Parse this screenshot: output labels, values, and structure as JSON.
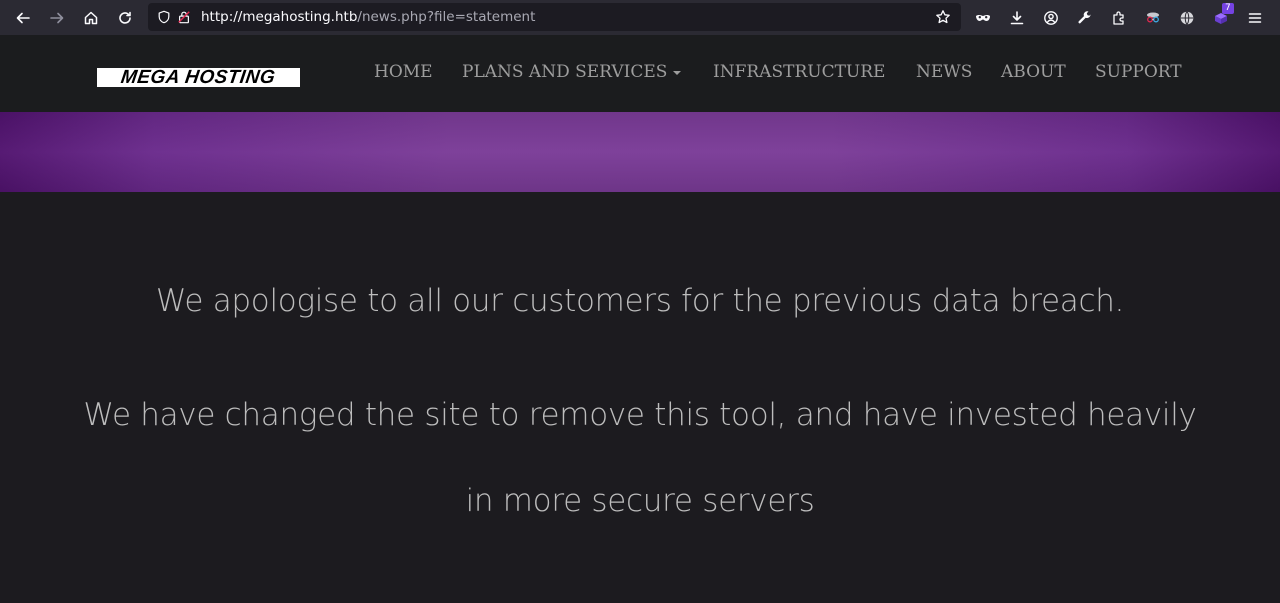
{
  "browser": {
    "url_host": "http://megahosting.htb",
    "url_path": "/news.php?file=statement",
    "extensions_badge": "7",
    "icons": [
      "back-arrow-icon",
      "forward-arrow-icon",
      "home-icon",
      "reload-icon",
      "shield-icon",
      "lock-insecure-icon",
      "star-icon",
      "mask-icon",
      "download-icon",
      "account-icon",
      "wrench-icon",
      "puzzle-icon",
      "spy-icon",
      "globe-icon",
      "extension-icon",
      "menu-icon"
    ]
  },
  "site": {
    "logo": "MEGA HOSTING",
    "nav": [
      {
        "label": "HOME"
      },
      {
        "label": "PLANS AND SERVICES"
      },
      {
        "label": "INFRASTRUCTURE"
      },
      {
        "label": "NEWS"
      },
      {
        "label": "ABOUT"
      },
      {
        "label": "SUPPORT"
      }
    ],
    "colors": {
      "banner": "#7a3b97",
      "background": "#1c1b1f",
      "text": "#bdbdbd"
    }
  },
  "content": {
    "line1": "We apologise to all our customers for the previous data breach.",
    "line2": "We have changed the site to remove this tool, and have invested heavily",
    "line3": "in more secure servers"
  }
}
